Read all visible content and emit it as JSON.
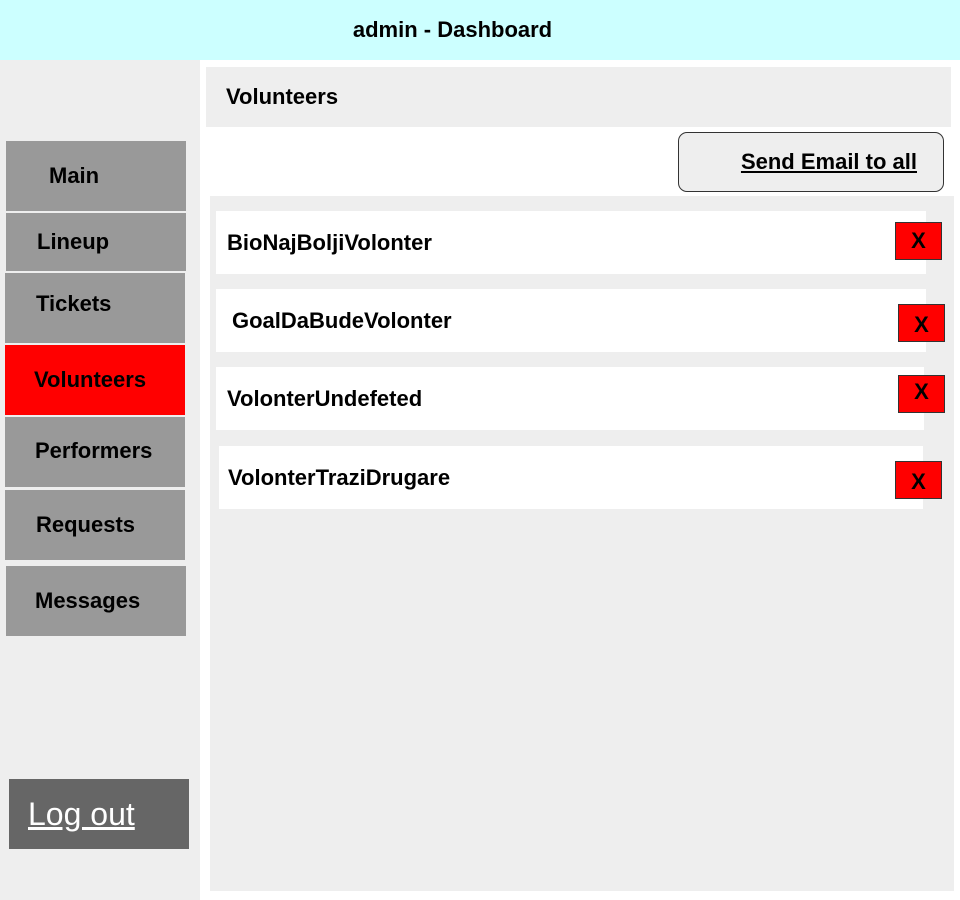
{
  "header": {
    "title": "admin - Dashboard"
  },
  "sidebar": {
    "items": [
      {
        "label": "Main"
      },
      {
        "label": "Lineup"
      },
      {
        "label": "Tickets"
      },
      {
        "label": "Volunteers",
        "active": true
      },
      {
        "label": "Performers"
      },
      {
        "label": "Requests"
      },
      {
        "label": "Messages"
      }
    ],
    "logout_label": "Log out"
  },
  "main": {
    "section_title": "Volunteers",
    "send_email_label": "Send Email to all",
    "volunteers": [
      {
        "name": "BioNajBoljiVolonter",
        "delete_label": "X"
      },
      {
        "name": "GoalDaBudeVolonter",
        "delete_label": "X"
      },
      {
        "name": "VolonterUndefeted",
        "delete_label": "X"
      },
      {
        "name": "VolonterTraziDrugare",
        "delete_label": "X"
      }
    ]
  },
  "colors": {
    "header_bg": "#ccffff",
    "nav_bg": "#999999",
    "nav_active_bg": "#ff0000",
    "logout_bg": "#666666",
    "delete_bg": "#ff0000",
    "panel_bg": "#eeeeee"
  }
}
